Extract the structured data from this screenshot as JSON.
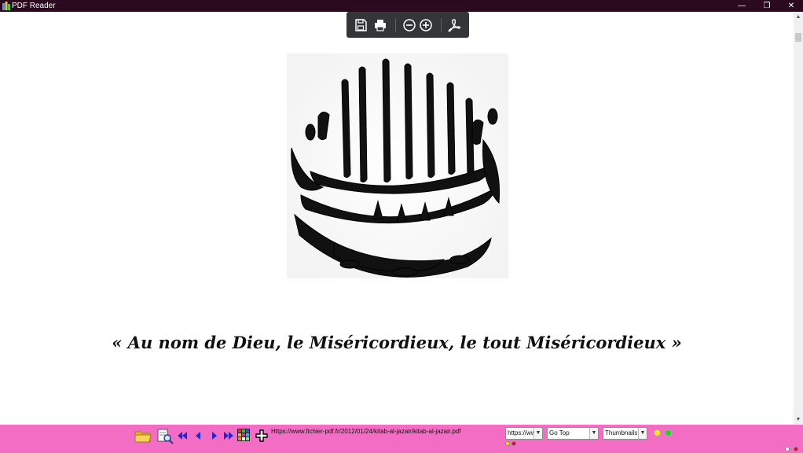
{
  "window": {
    "title": "PDF Reader",
    "minimize": "—",
    "maximize": "❐",
    "close": "✕"
  },
  "toolbar": {
    "icons": [
      "save-icon",
      "print-icon",
      "zoom-out-icon",
      "zoom-in-icon",
      "acrobat-icon"
    ]
  },
  "document": {
    "image": "bismillah-calligraphy",
    "caption": "« Au nom de Dieu, le Miséricordieux, le tout Miséricordieux »"
  },
  "bottombar": {
    "url": "Https://www.fichier-pdf.fr/2012/01/24/kitab-al-jazair/kitab-al-jazair.pdf",
    "url_combo_value": "https://ww",
    "goto_value": "Go Top",
    "view_value": "Thumbnails",
    "colors": {
      "bar": "#f46dc4",
      "yellow": "#ffe600",
      "green": "#23d321",
      "red": "#e0002a"
    }
  }
}
